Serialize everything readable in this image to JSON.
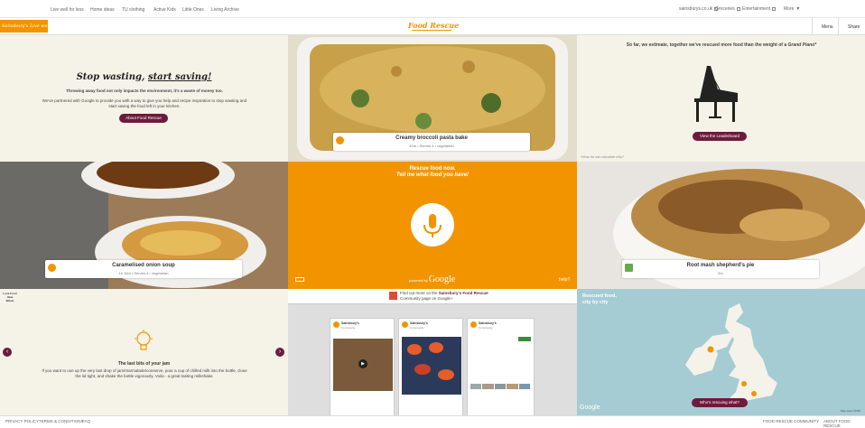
{
  "topnav": {
    "left_links": [
      "Live well for less",
      "Home ideas",
      "TU clothing",
      "Active Kids",
      "Little Ones",
      "Living Archive"
    ],
    "right_links": [
      "sainsburys.co.uk",
      "Groceries",
      "Entertainment"
    ],
    "more": "More"
  },
  "brand": {
    "sainsburys_logo": "Sainsbury's Live well for less",
    "food_rescue_logo": "Food Rescue",
    "menu_button": "Menu",
    "share_button": "Share"
  },
  "intro": {
    "title_a": "Stop wasting, ",
    "title_b": "start saving!",
    "subtitle": "Throwing away food not only impacts the environment, it's a waste of money too.",
    "body": "We've partnered with Google to provide you with a way to give you help and recipe inspiration to stop wasting and start saving the food left in your kitchen.",
    "button": "About Food Rescue"
  },
  "recipes": [
    {
      "title": "Creamy broccoli pasta bake",
      "meta": "40m • Serves 4 • vegetarian"
    },
    {
      "title": "Caramelised onion soup",
      "meta": "1h 15m • Serves 4 • vegetarian"
    },
    {
      "title": "Root mash shepherd's pie",
      "meta": "2hr"
    }
  ],
  "leaderboard": {
    "text_a": "So far, we estimate, together we've rescued more food than the weight of a ",
    "text_b": "Grand Piano*",
    "button": "View the Leaderboard",
    "note": "*How do we calculate this?"
  },
  "voice": {
    "line1": "Rescue food now.",
    "line2": "Tell me what food you have!",
    "powered_prefix": "powered by",
    "powered_brand": "Google",
    "help": "help?"
  },
  "tip": {
    "logo": "Love Food Hate Waste",
    "title": "The last bits of your jam",
    "body": "If you want to use up the very last drop of jam/marmalade/conserve, pour a cup of chilled milk into the bottle, close the lid tight, and shake the bottle vigorously. Voila - a great tasting milkshake."
  },
  "community": {
    "line1_prefix": "Find out more on the ",
    "line1_link": "Sainsbury's Food Rescue",
    "line2": "Community page on Google+",
    "cards": [
      {
        "name": "Sainsbury's",
        "followers": "Community"
      },
      {
        "name": "Sainsbury's",
        "followers": "Community"
      },
      {
        "name": "Sainsbury's",
        "followers": "Community"
      }
    ]
  },
  "map": {
    "title_line1": "Rescued food,",
    "title_line2": "city by city",
    "button": "Who's rescuing what?",
    "google": "Google",
    "credit": "Map data ©2015"
  },
  "footer": {
    "left": [
      "PRIVACY POLICY",
      "TERMS & CONDITIONS",
      "FAQ"
    ],
    "right": [
      "FOOD RESCUE COMMUNITY",
      "ABOUT FOOD RESCUE"
    ]
  },
  "colors": {
    "orange": "#f29400",
    "plum": "#6d1b3b",
    "cream": "#f5f3e8",
    "map_sea": "#a5cbd3"
  }
}
